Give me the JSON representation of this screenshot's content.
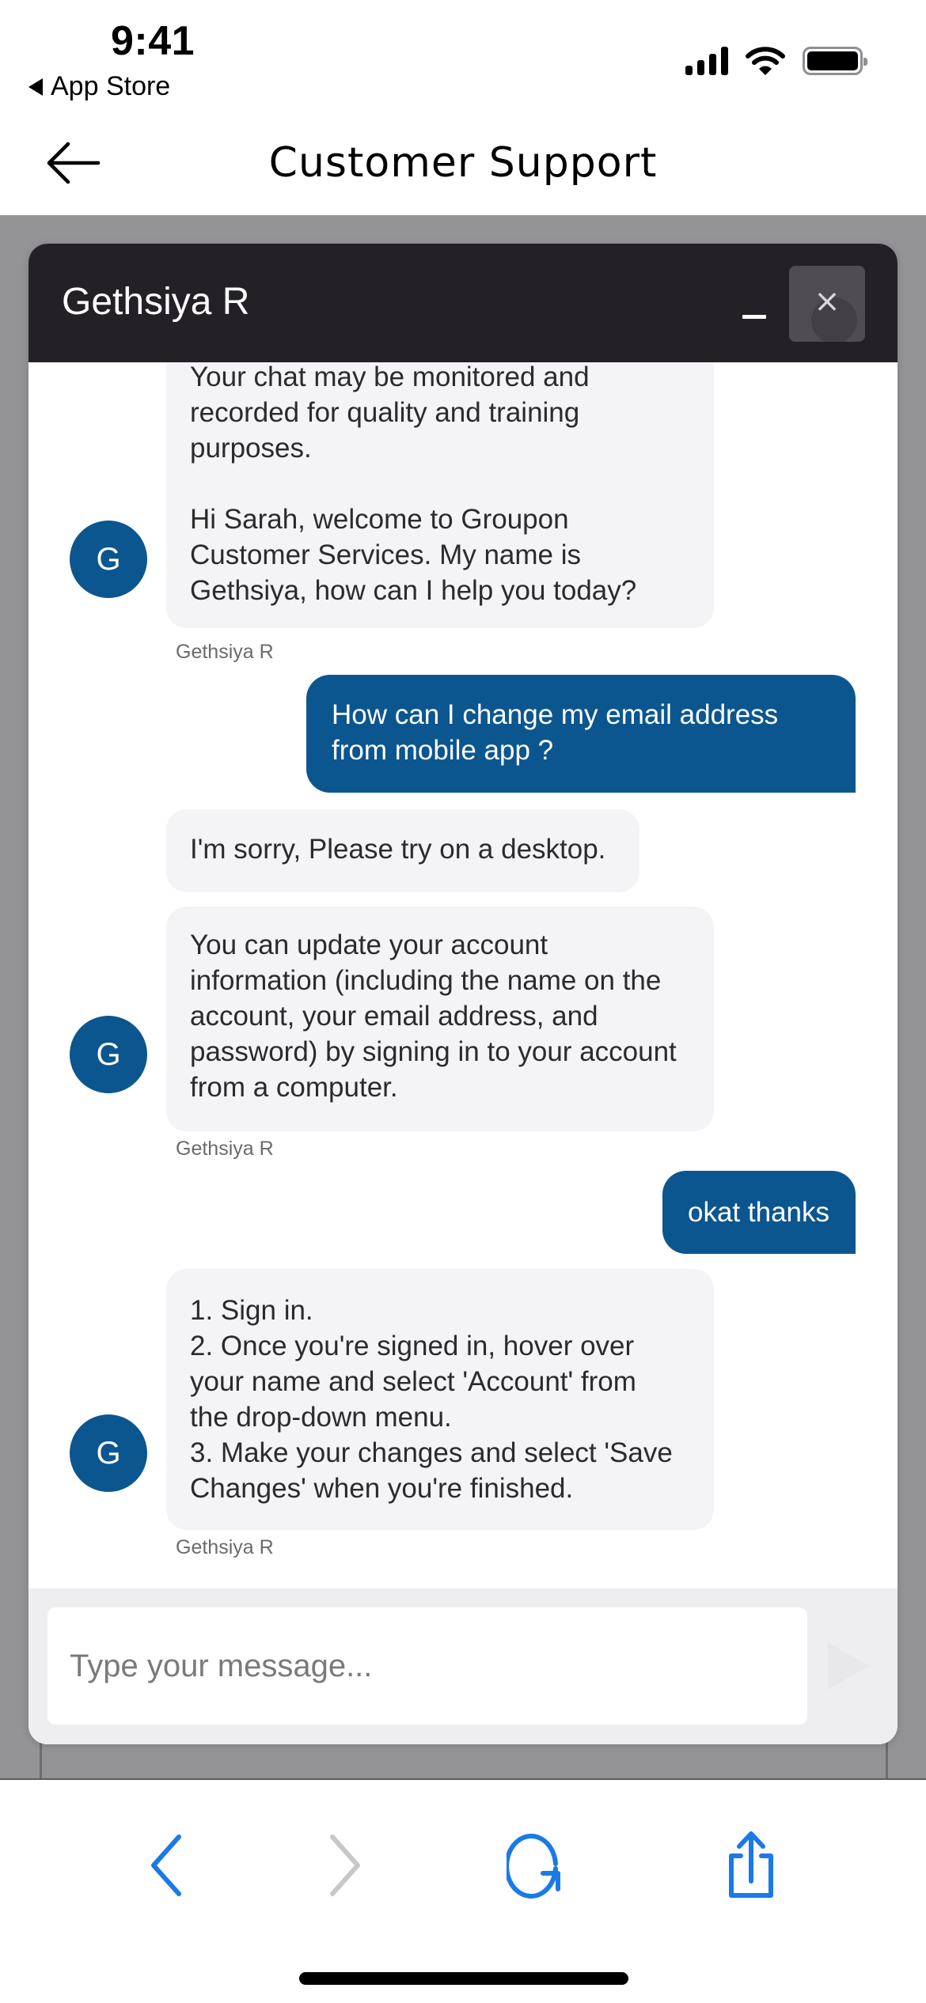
{
  "status_bar": {
    "time": "9:41",
    "back_app": "App Store",
    "icons": [
      "cellular-signal-icon",
      "wifi-icon",
      "battery-icon"
    ]
  },
  "nav": {
    "title": "Customer Support",
    "back_icon": "arrow-left-icon"
  },
  "chat": {
    "agent_name": "Gethsiya R",
    "minimize_icon": "minimize-icon",
    "close_label": "×",
    "avatar_initial": "G",
    "accent_color": "#0c5690",
    "messages": [
      {
        "from": "agent",
        "text": "Your chat may be monitored and\nrecorded for quality and training\npurposes.\n\nHi Sarah, welcome to Groupon\nCustomer Services. My name is\nGethsiya, how can I help you today?",
        "sender": "Gethsiya R",
        "show_avatar": true
      },
      {
        "from": "user",
        "text": "How can I change my email address\nfrom mobile app ?"
      },
      {
        "from": "agent",
        "text": "I'm sorry, Please try on a desktop.",
        "show_avatar": false
      },
      {
        "from": "agent",
        "text": "You can update your account\ninformation (including the name on the\naccount, your email address, and\npassword) by signing in to your account\nfrom a computer.",
        "sender": "Gethsiya R",
        "show_avatar": true
      },
      {
        "from": "user",
        "text": "okat thanks"
      },
      {
        "from": "agent",
        "text": "1. Sign in.\n2. Once you're signed in, hover over\nyour name and select 'Account' from\nthe drop-down menu.\n3. Make your changes and select 'Save\nChanges' when you're finished.",
        "sender": "Gethsiya R",
        "show_avatar": true
      }
    ],
    "input": {
      "value": "",
      "placeholder": "Type your message..."
    },
    "send_icon": "send-icon"
  },
  "toolbar": {
    "items": [
      {
        "name": "back",
        "icon": "chevron-left-icon",
        "enabled": true
      },
      {
        "name": "forward",
        "icon": "chevron-right-icon",
        "enabled": false
      },
      {
        "name": "reload",
        "icon": "reload-icon",
        "enabled": true
      },
      {
        "name": "share",
        "icon": "share-icon",
        "enabled": true
      }
    ],
    "active_color": "#1a7ae6",
    "disabled_color": "#c7c7c9"
  }
}
